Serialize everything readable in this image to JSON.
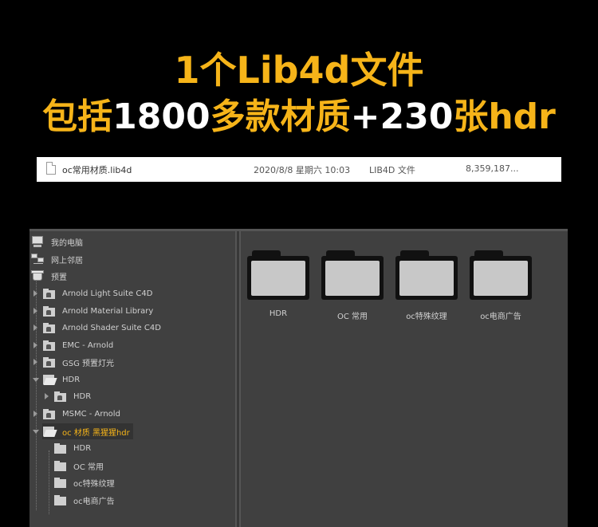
{
  "headline": {
    "line1": "1个Lib4d文件",
    "line2_pre": "包括",
    "line2_num1": "1800",
    "line2_mid": "多款材质",
    "line2_plus": "+230",
    "line2_post": "张hdr"
  },
  "file_row": {
    "name": "oc常用材质.lib4d",
    "date": "2020/8/8 星期六 10:03",
    "type": "LIB4D 文件",
    "size": "8,359,187..."
  },
  "tree": [
    {
      "label": "我的电脑",
      "icon": "computer-icon"
    },
    {
      "label": "网上邻居",
      "icon": "network-icon"
    },
    {
      "label": "预置",
      "icon": "preset-box-icon"
    },
    {
      "label": "Arnold Light Suite C4D",
      "icon": "locked-folder-icon"
    },
    {
      "label": "Arnold Material Library",
      "icon": "locked-folder-icon"
    },
    {
      "label": "Arnold Shader Suite C4D",
      "icon": "locked-folder-icon"
    },
    {
      "label": "EMC - Arnold",
      "icon": "locked-folder-icon"
    },
    {
      "label": "GSG 预置灯光",
      "icon": "locked-folder-icon"
    },
    {
      "label": "HDR",
      "icon": "open-locked-folder-icon"
    },
    {
      "label": "HDR",
      "icon": "locked-folder-icon"
    },
    {
      "label": "MSMC - Arnold",
      "icon": "locked-folder-icon"
    },
    {
      "label": "oc 材质 黑猩猩hdr",
      "icon": "open-folder-icon"
    },
    {
      "label": "HDR",
      "icon": "folder-icon"
    },
    {
      "label": "OC 常用",
      "icon": "folder-icon"
    },
    {
      "label": "oc特殊纹理",
      "icon": "folder-icon"
    },
    {
      "label": "oc电商广告",
      "icon": "folder-icon"
    }
  ],
  "folders": [
    {
      "label": "HDR"
    },
    {
      "label": "OC 常用"
    },
    {
      "label": "oc特殊纹理"
    },
    {
      "label": "oc电商广告"
    }
  ],
  "colors": {
    "accent": "#f6b419",
    "panel_bg": "#404040"
  }
}
